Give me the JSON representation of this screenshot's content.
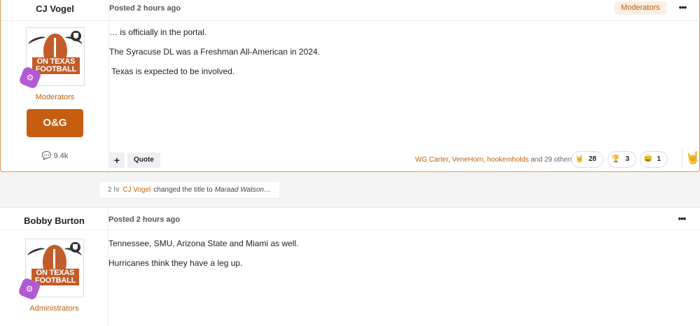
{
  "post1": {
    "author": "CJ Vogel",
    "posted": "Posted 2 hours ago",
    "role_badge": "Moderators",
    "more": "•••",
    "logo_text_1": "ON TEXAS",
    "logo_text_2": "FOOTBALL",
    "group": "Moderators",
    "group_image_text": "O&G",
    "post_count": "9.4k",
    "content": [
      "… is officially in the portal.",
      "The Syracuse DL was a Freshman All-American in 2024.",
      " Texas is expected to be involved."
    ],
    "plus_label": "+",
    "quote_label": "Quote",
    "reactors": {
      "names": [
        "WG Carter",
        "VeneHorn",
        "hookemholds"
      ],
      "separator": ", ",
      "suffix": " and 29 others"
    },
    "reactions": [
      {
        "icon": "hook-em-horns-icon",
        "glyph": "🤘",
        "count": "28",
        "color": "#f5c64a"
      },
      {
        "icon": "trophy-icon",
        "glyph": "🏆",
        "count": "3",
        "color": "#8a4bb0"
      },
      {
        "icon": "laughing-face-icon",
        "glyph": "😄",
        "count": "1",
        "color": "#f3c33b"
      }
    ],
    "react_trigger_glyph": "🤘"
  },
  "event": {
    "time": "2 hr",
    "user": "CJ Vogel",
    "text": "changed the title to",
    "title": "Maraad Watson…"
  },
  "post2": {
    "author": "Bobby Burton",
    "posted": "Posted 2 hours ago",
    "more": "•••",
    "logo_text_1": "ON TEXAS",
    "logo_text_2": "FOOTBALL",
    "group": "Administrators",
    "content": [
      "Tennessee, SMU, Arizona State and Miami as well.",
      "Hurricanes think they have a leg up."
    ]
  },
  "colors": {
    "accent": "#c0620c",
    "badge_bg": "#fbeee2",
    "rank_badge": "#b15ad3",
    "post_border": "#e09a55"
  }
}
